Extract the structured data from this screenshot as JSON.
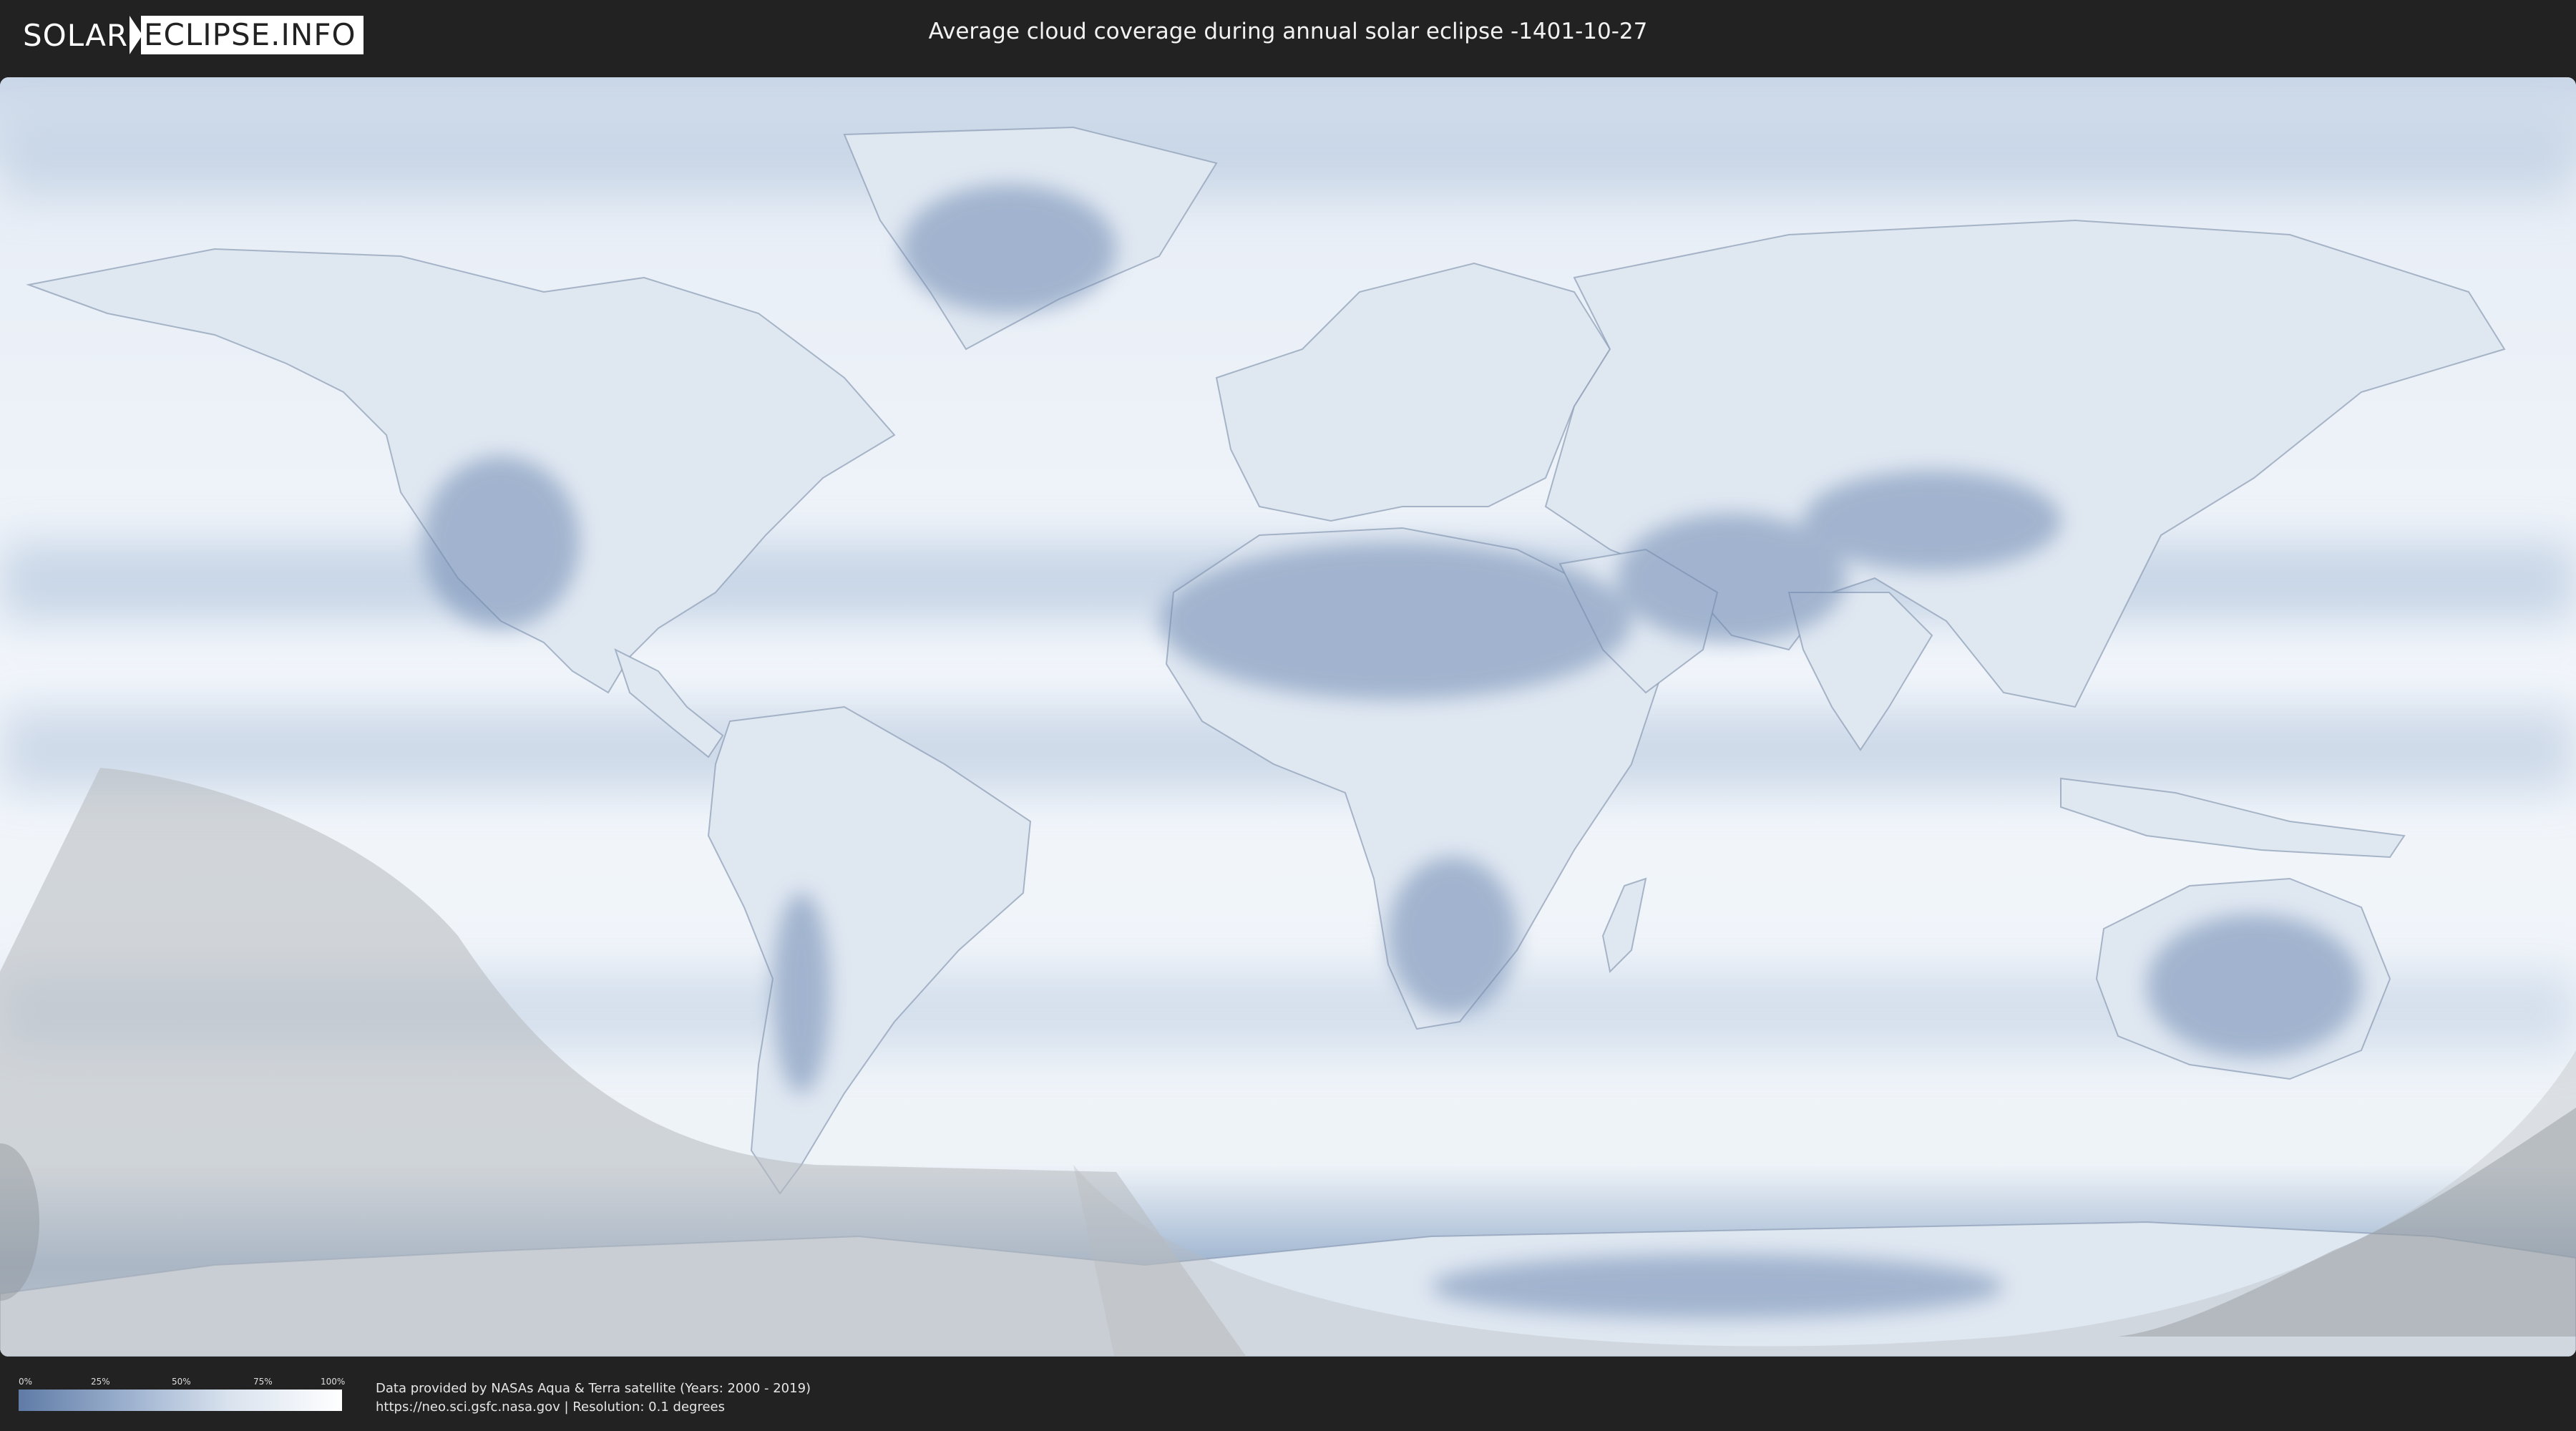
{
  "header": {
    "logo_left": "SOLAR",
    "logo_right": "ECLIPSE.INFO",
    "title": "Average cloud coverage during annual solar eclipse -1401-10-27"
  },
  "map": {
    "type": "equirectangular world map",
    "layer": "average cloud coverage",
    "colors": {
      "clear": "#5f7ba6",
      "cloudy": "#ffffff",
      "eclipse_shadow": "#b9bcbf",
      "coastline": "#8a9bb3"
    }
  },
  "legend": {
    "ticks": [
      "0%",
      "25%",
      "50%",
      "75%",
      "100%"
    ],
    "tick_fractions": [
      0,
      0.25,
      0.5,
      0.75,
      1.0
    ],
    "colors": [
      "#5f7ba6",
      "#ffffff"
    ]
  },
  "footer": {
    "credit_line1": "Data provided by NASAs Aqua & Terra satellite (Years: 2000 - 2019)",
    "credit_line2": "https://neo.sci.gsfc.nasa.gov | Resolution: 0.1 degrees"
  }
}
